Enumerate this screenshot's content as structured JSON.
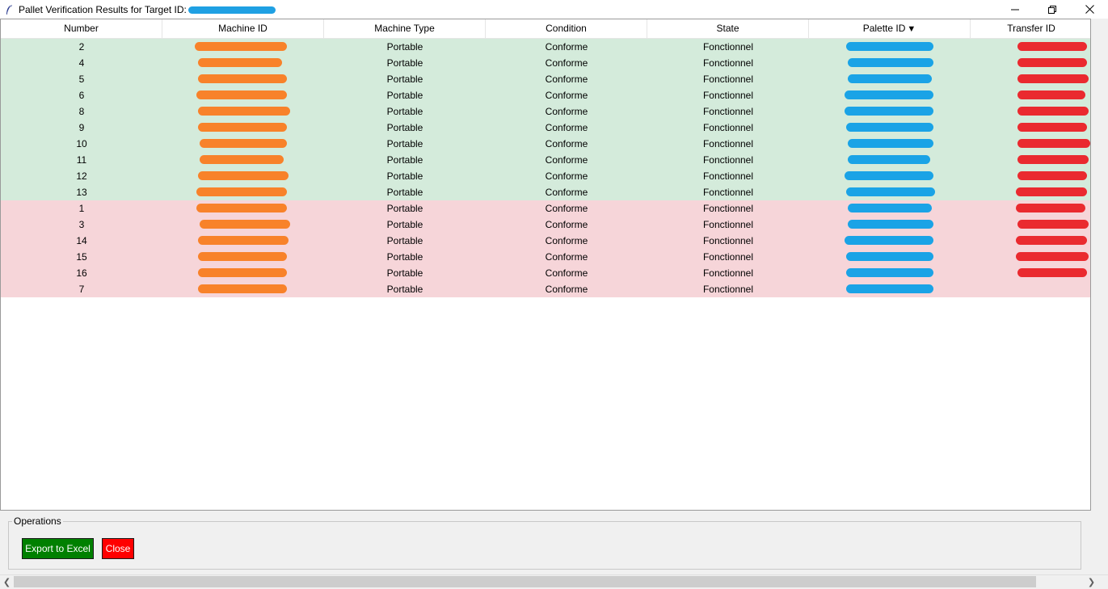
{
  "window": {
    "title": "Pallet Verification Results for Target ID:",
    "controls": [
      "minimize",
      "restore",
      "close"
    ]
  },
  "table": {
    "columns": [
      "Number",
      "Machine ID",
      "Machine Type",
      "Condition",
      "State",
      "Palette ID",
      "Transfer ID"
    ],
    "sort_column": "Palette ID",
    "sort_indicator": "▼",
    "rows": [
      {
        "number": "2",
        "machine_type": "Portable",
        "condition": "Conforme",
        "state": "Fonctionnel",
        "status": "ok"
      },
      {
        "number": "4",
        "machine_type": "Portable",
        "condition": "Conforme",
        "state": "Fonctionnel",
        "status": "ok"
      },
      {
        "number": "5",
        "machine_type": "Portable",
        "condition": "Conforme",
        "state": "Fonctionnel",
        "status": "ok"
      },
      {
        "number": "6",
        "machine_type": "Portable",
        "condition": "Conforme",
        "state": "Fonctionnel",
        "status": "ok"
      },
      {
        "number": "8",
        "machine_type": "Portable",
        "condition": "Conforme",
        "state": "Fonctionnel",
        "status": "ok"
      },
      {
        "number": "9",
        "machine_type": "Portable",
        "condition": "Conforme",
        "state": "Fonctionnel",
        "status": "ok"
      },
      {
        "number": "10",
        "machine_type": "Portable",
        "condition": "Conforme",
        "state": "Fonctionnel",
        "status": "ok"
      },
      {
        "number": "11",
        "machine_type": "Portable",
        "condition": "Conforme",
        "state": "Fonctionnel",
        "status": "ok"
      },
      {
        "number": "12",
        "machine_type": "Portable",
        "condition": "Conforme",
        "state": "Fonctionnel",
        "status": "ok"
      },
      {
        "number": "13",
        "machine_type": "Portable",
        "condition": "Conforme",
        "state": "Fonctionnel",
        "status": "ok"
      },
      {
        "number": "1",
        "machine_type": "Portable",
        "condition": "Conforme",
        "state": "Fonctionnel",
        "status": "bad"
      },
      {
        "number": "3",
        "machine_type": "Portable",
        "condition": "Conforme",
        "state": "Fonctionnel",
        "status": "bad"
      },
      {
        "number": "14",
        "machine_type": "Portable",
        "condition": "Conforme",
        "state": "Fonctionnel",
        "status": "bad"
      },
      {
        "number": "15",
        "machine_type": "Portable",
        "condition": "Conforme",
        "state": "Fonctionnel",
        "status": "bad"
      },
      {
        "number": "16",
        "machine_type": "Portable",
        "condition": "Conforme",
        "state": "Fonctionnel",
        "status": "bad"
      },
      {
        "number": "7",
        "machine_type": "Portable",
        "condition": "Conforme",
        "state": "Fonctionnel",
        "status": "bad"
      }
    ]
  },
  "operations": {
    "legend": "Operations",
    "export_label": "Export to Excel",
    "close_label": "Close"
  },
  "colors": {
    "row_ok": "#d4ebdb",
    "row_bad": "#f6d5d9",
    "export_button": "#008000",
    "close_button": "#ff0000",
    "redaction_machine_id": "#f8822a",
    "redaction_palette_id": "#1aa3e6",
    "redaction_transfer_id": "#ea2a2f"
  }
}
